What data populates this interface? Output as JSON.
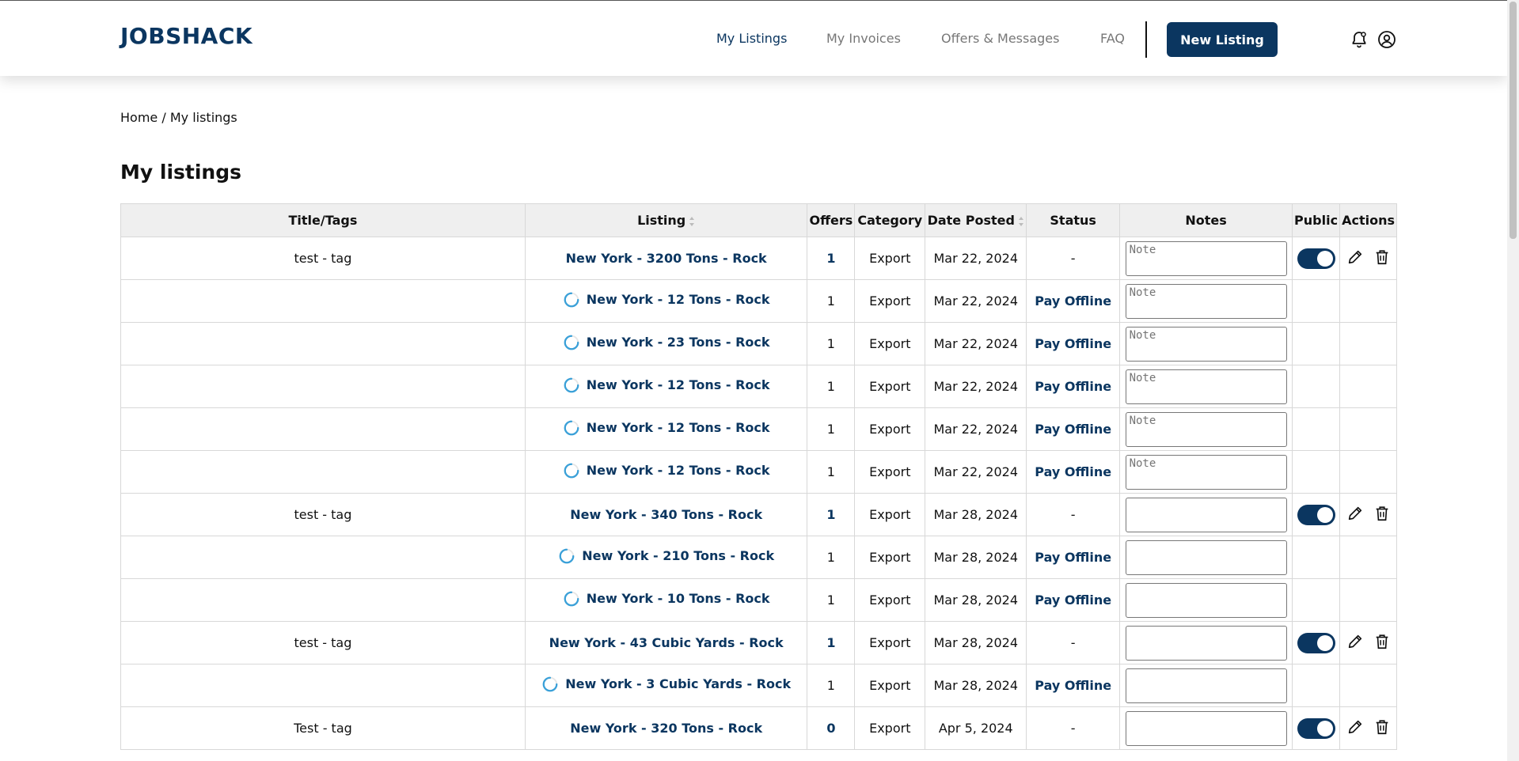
{
  "brand": {
    "name": "JOBSHACK",
    "accent": "#0b3660"
  },
  "nav": {
    "items": [
      {
        "label": "My Listings",
        "active": true
      },
      {
        "label": "My Invoices",
        "active": false
      },
      {
        "label": "Offers & Messages",
        "active": false
      },
      {
        "label": "FAQ",
        "active": false
      }
    ],
    "cta": "New Listing",
    "icons": [
      "bell-icon",
      "user-icon"
    ]
  },
  "breadcrumb": {
    "home": "Home",
    "separator": "/",
    "current": "My listings"
  },
  "page": {
    "title": "My listings"
  },
  "table": {
    "headers": {
      "title_tags": "Title/Tags",
      "listing": "Listing",
      "offers": "Offers",
      "category": "Category",
      "date_posted": "Date Posted",
      "status": "Status",
      "notes": "Notes",
      "public": "Public",
      "actions": "Actions"
    },
    "rows": [
      {
        "tag": "test - tag",
        "listing": "New York - 3200 Tons - Rock",
        "offers": "1",
        "category": "Export",
        "date": "Mar 22, 2024",
        "status": "-",
        "note_placeholder": "Note",
        "parent": true
      },
      {
        "tag": "",
        "listing": "New York - 12 Tons - Rock",
        "offers": "1",
        "category": "Export",
        "date": "Mar 22, 2024",
        "status": "Pay Offline",
        "note_placeholder": "Note",
        "parent": false
      },
      {
        "tag": "",
        "listing": "New York - 23 Tons - Rock",
        "offers": "1",
        "category": "Export",
        "date": "Mar 22, 2024",
        "status": "Pay Offline",
        "note_placeholder": "Note",
        "parent": false
      },
      {
        "tag": "",
        "listing": "New York - 12 Tons - Rock",
        "offers": "1",
        "category": "Export",
        "date": "Mar 22, 2024",
        "status": "Pay Offline",
        "note_placeholder": "Note",
        "parent": false
      },
      {
        "tag": "",
        "listing": "New York - 12 Tons - Rock",
        "offers": "1",
        "category": "Export",
        "date": "Mar 22, 2024",
        "status": "Pay Offline",
        "note_placeholder": "Note",
        "parent": false
      },
      {
        "tag": "",
        "listing": "New York - 12 Tons - Rock",
        "offers": "1",
        "category": "Export",
        "date": "Mar 22, 2024",
        "status": "Pay Offline",
        "note_placeholder": "Note",
        "parent": false
      },
      {
        "tag": "test - tag",
        "listing": "New York - 340 Tons - Rock",
        "offers": "1",
        "category": "Export",
        "date": "Mar 28, 2024",
        "status": "-",
        "note_placeholder": "",
        "parent": true
      },
      {
        "tag": "",
        "listing": "New York - 210 Tons - Rock",
        "offers": "1",
        "category": "Export",
        "date": "Mar 28, 2024",
        "status": "Pay Offline",
        "note_placeholder": "",
        "parent": false
      },
      {
        "tag": "",
        "listing": "New York - 10 Tons - Rock",
        "offers": "1",
        "category": "Export",
        "date": "Mar 28, 2024",
        "status": "Pay Offline",
        "note_placeholder": "",
        "parent": false
      },
      {
        "tag": "test - tag",
        "listing": "New York - 43 Cubic Yards - Rock",
        "offers": "1",
        "category": "Export",
        "date": "Mar 28, 2024",
        "status": "-",
        "note_placeholder": "",
        "parent": true
      },
      {
        "tag": "",
        "listing": "New York - 3 Cubic Yards - Rock",
        "offers": "1",
        "category": "Export",
        "date": "Mar 28, 2024",
        "status": "Pay Offline",
        "note_placeholder": "",
        "parent": false
      },
      {
        "tag": "Test - tag",
        "listing": "New York - 320 Tons - Rock",
        "offers": "0",
        "category": "Export",
        "date": "Apr 5, 2024",
        "status": "-",
        "note_placeholder": "",
        "parent": true
      }
    ]
  }
}
